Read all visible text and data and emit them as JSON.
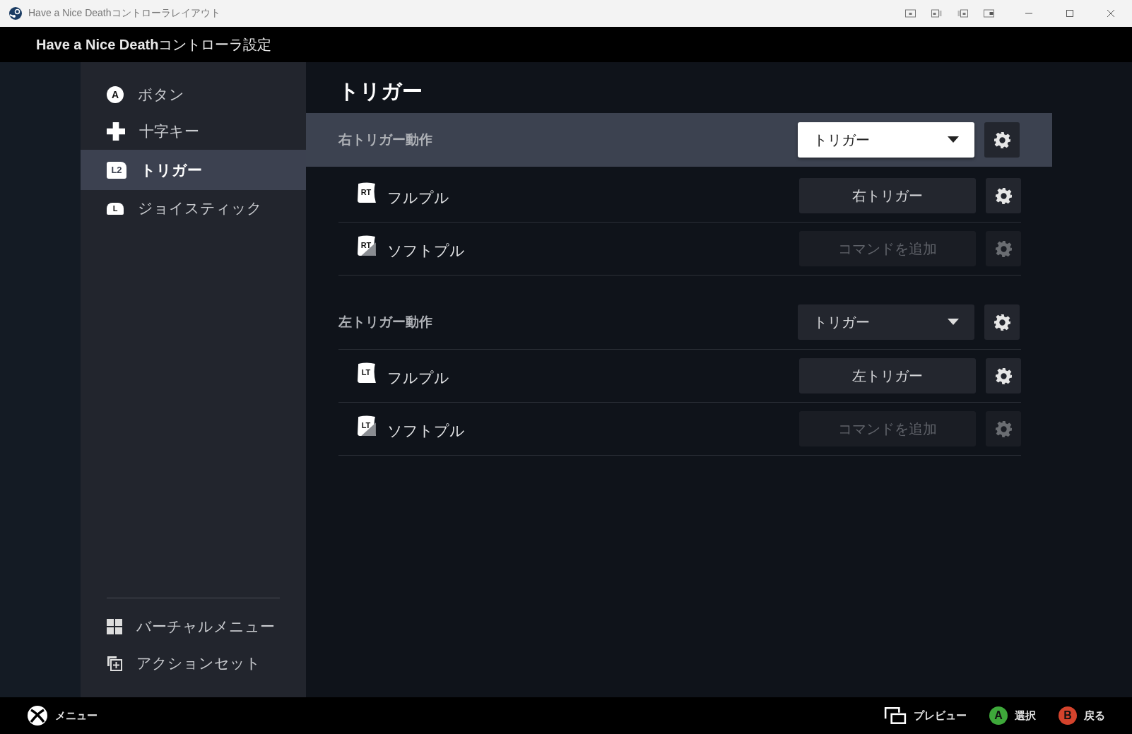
{
  "window": {
    "title": "Have a Nice Deathコントローラレイアウト"
  },
  "header": {
    "title": "**Have a Nice Death**コントローラ設定"
  },
  "sidebar": {
    "items": [
      {
        "kind": "face",
        "glyph": "A",
        "label": "ボタン",
        "selected": false
      },
      {
        "kind": "dpad",
        "label": "十字キー",
        "selected": false
      },
      {
        "kind": "trigger",
        "glyph": "L2",
        "label": "トリガー",
        "selected": true
      },
      {
        "kind": "stick",
        "glyph": "L",
        "label": "ジョイスティック",
        "selected": false
      }
    ],
    "extras": [
      {
        "kind": "grid",
        "label": "バーチャルメニュー"
      },
      {
        "kind": "actionset",
        "label": "アクションセット"
      }
    ]
  },
  "main": {
    "title": "トリガー",
    "sections": [
      {
        "title": "右トリガー動作",
        "selected": true,
        "mode": "トリガー",
        "rows": [
          {
            "kind": "full",
            "glyph": "RT",
            "label": "フルプル",
            "binding": "右トリガー",
            "disabled": false
          },
          {
            "kind": "soft",
            "glyph": "RT",
            "label": "ソフトプル",
            "binding": "コマンドを追加",
            "disabled": true
          }
        ]
      },
      {
        "title": "左トリガー動作",
        "selected": false,
        "mode": "トリガー",
        "rows": [
          {
            "kind": "full",
            "glyph": "LT",
            "label": "フルプル",
            "binding": "左トリガー",
            "disabled": false
          },
          {
            "kind": "soft",
            "glyph": "LT",
            "label": "ソフトプル",
            "binding": "コマンドを追加",
            "disabled": true
          }
        ]
      }
    ]
  },
  "footer": {
    "menu": "メニュー",
    "hints": [
      {
        "kind": "preview",
        "label": "プレビュー"
      },
      {
        "kind": "button",
        "glyph": "A",
        "color": "#3ea83a",
        "label": "選択"
      },
      {
        "kind": "button",
        "glyph": "B",
        "color": "#d4432c",
        "label": "戻る"
      }
    ]
  }
}
